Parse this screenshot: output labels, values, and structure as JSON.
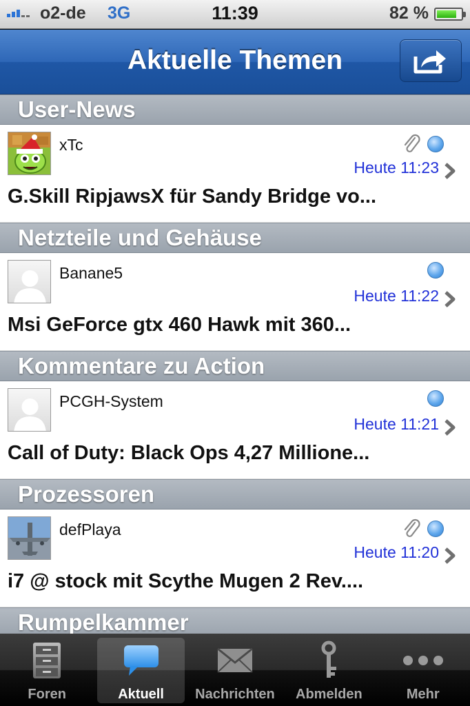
{
  "status_bar": {
    "carrier": "o2-de",
    "network": "3G",
    "time": "11:39",
    "battery": "82 %",
    "battery_level": 0.82
  },
  "nav": {
    "title": "Aktuelle Themen",
    "action_icon": "share-icon"
  },
  "sections": [
    {
      "header": "User-News",
      "topic": {
        "author": "xTc",
        "avatar": "cartoon-avatar",
        "has_attachment": true,
        "unread": true,
        "time": "Heute 11:23",
        "title": "G.Skill RipjawsX für Sandy Bridge vo..."
      }
    },
    {
      "header": "Netzteile und Gehäuse",
      "topic": {
        "author": "Banane5",
        "avatar": "placeholder-avatar",
        "has_attachment": false,
        "unread": true,
        "time": "Heute 11:22",
        "title": "Msi GeForce gtx 460 Hawk mit 360..."
      }
    },
    {
      "header": "Kommentare zu Action",
      "topic": {
        "author": "PCGH-System",
        "avatar": "placeholder-avatar",
        "has_attachment": false,
        "unread": true,
        "time": "Heute 11:21",
        "title": "Call of Duty: Black Ops 4,27 Millione..."
      }
    },
    {
      "header": "Prozessoren",
      "topic": {
        "author": "defPlaya",
        "avatar": "airplane-avatar",
        "has_attachment": true,
        "unread": true,
        "time": "Heute 11:20",
        "title": "i7 @ stock mit Scythe Mugen 2 Rev...."
      }
    },
    {
      "header": "Rumpelkammer"
    }
  ],
  "tabs": [
    {
      "label": "Foren",
      "icon": "cabinet-icon",
      "active": false
    },
    {
      "label": "Aktuell",
      "icon": "speech-bubble-icon",
      "active": true
    },
    {
      "label": "Nachrichten",
      "icon": "envelope-icon",
      "active": false
    },
    {
      "label": "Abmelden",
      "icon": "key-icon",
      "active": false
    },
    {
      "label": "Mehr",
      "icon": "more-icon",
      "active": false
    }
  ]
}
